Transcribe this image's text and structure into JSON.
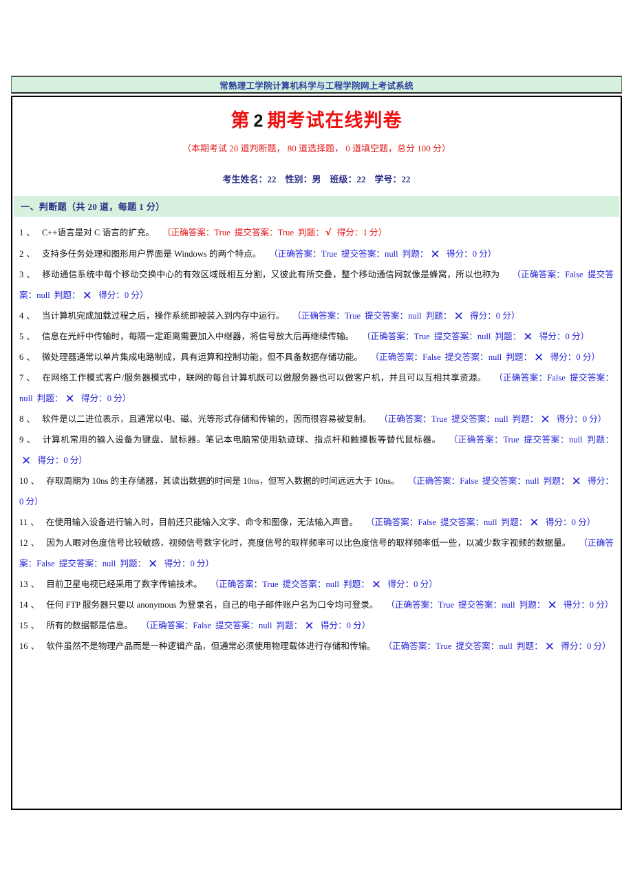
{
  "banner": {
    "site_title": "常熟理工学院计算机科学与工程学院网上考试系统"
  },
  "header": {
    "title_prefix": "第",
    "period_number": "2",
    "title_suffix": "期考试在线判卷",
    "summary": "（本期考试 20 道判断题， 80 道选择题， 0 道填空题，总分 100 分）",
    "student": {
      "name_label": "考生姓名：",
      "name_value": "22",
      "gender_label": "性别：",
      "gender_value": "男",
      "class_label": "班级：",
      "class_value": "22",
      "id_label": "学号：",
      "id_value": "22"
    }
  },
  "section": {
    "heading": "一、判断题（共 20 道，每题 1 分）"
  },
  "labels": {
    "correct_answer": "正确答案：",
    "submitted_answer": "提交答案：",
    "judgement": "判题：",
    "score": "得分：",
    "open_paren": "（",
    "close_paren": "）",
    "mark_right": "√",
    "mark_wrong": "✕",
    "num_sep": "、"
  },
  "colors": {
    "banner_bg": "#d6f2df",
    "banner_text": "#2b3f9e",
    "title_red": "#f01010",
    "student_navy": "#2d2f86",
    "answer_correct": "#e81010",
    "answer_wrong": "#2323d8",
    "border": "#000000"
  },
  "questions": [
    {
      "num": "1",
      "text": "C++语言是对 C 语言的扩充。",
      "correct_answer": "True",
      "submitted_answer": "True",
      "judgement": "√",
      "score": "1 分",
      "state": "correct"
    },
    {
      "num": "2",
      "text": "支持多任务处理和图形用户界面是 Windows 的两个特点。",
      "correct_answer": "True",
      "submitted_answer": "null",
      "judgement": "✕",
      "score": "0 分",
      "state": "wrong"
    },
    {
      "num": "3",
      "text": "移动通信系统中每个移动交换中心的有效区域既相互分割，又彼此有所交叠，整个移动通信网就像是蜂窝，所以也称为",
      "correct_answer": "False",
      "submitted_answer": "null",
      "judgement": "✕",
      "score": "0 分",
      "state": "wrong"
    },
    {
      "num": "4",
      "text": "当计算机完成加载过程之后，操作系统即被装入到内存中运行。",
      "correct_answer": "True",
      "submitted_answer": "null",
      "judgement": "✕",
      "score": "0 分",
      "state": "wrong"
    },
    {
      "num": "5",
      "text": "信息在光纤中传输时，每隔一定距离需要加入中继器，将信号放大后再继续传输。",
      "correct_answer": "True",
      "submitted_answer": "null",
      "judgement": "✕",
      "score": "0 分",
      "state": "wrong"
    },
    {
      "num": "6",
      "text": "微处理器通常以单片集成电路制成，具有运算和控制功能，但不具备数据存储功能。",
      "correct_answer": "False",
      "submitted_answer": "null",
      "judgement": "✕",
      "score": "0 分",
      "state": "wrong"
    },
    {
      "num": "7",
      "text": "在网络工作模式客户/服务器模式中，联网的每台计算机既可以做服务器也可以做客户机，并且可以互相共享资源。",
      "correct_answer": "False",
      "submitted_answer": "null",
      "judgement": "✕",
      "score": "0 分",
      "state": "wrong"
    },
    {
      "num": "8",
      "text": "软件是以二进位表示，且通常以电、磁、光等形式存储和传输的，因而很容易被复制。",
      "correct_answer": "True",
      "submitted_answer": "null",
      "judgement": "✕",
      "score": "0 分",
      "state": "wrong"
    },
    {
      "num": "9",
      "text": "计算机常用的输入设备为键盘、鼠标器。笔记本电脑常使用轨迹球、指点杆和触摸板等替代鼠标器。",
      "correct_answer": "True",
      "submitted_answer": "null",
      "judgement": "✕",
      "score": "0 分",
      "state": "wrong"
    },
    {
      "num": "10",
      "text": "存取周期为 10ns 的主存储器，其读出数据的时间是 10ns，但写入数据的时间远远大于 10ns。",
      "correct_answer": "False",
      "submitted_answer": "null",
      "judgement": "✕",
      "score": "0 分",
      "state": "wrong"
    },
    {
      "num": "11",
      "text": "在使用输入设备进行输入时，目前还只能输入文字、命令和图像，无法输入声音。",
      "correct_answer": "False",
      "submitted_answer": "null",
      "judgement": "✕",
      "score": "0 分",
      "state": "wrong"
    },
    {
      "num": "12",
      "text": "因为人眼对色度信号比较敏感，视频信号数字化时，亮度信号的取样频率可以比色度信号的取样频率低一些，以减少数字视频的数据量。",
      "correct_answer": "False",
      "submitted_answer": "null",
      "judgement": "✕",
      "score": "0 分",
      "state": "wrong"
    },
    {
      "num": "13",
      "text": "目前卫星电视已经采用了数字传输技术。",
      "correct_answer": "True",
      "submitted_answer": "null",
      "judgement": "✕",
      "score": "0 分",
      "state": "wrong"
    },
    {
      "num": "14",
      "text": "任何 FTP 服务器只要以 anonymous 为登录名，自己的电子邮件账户名为口令均可登录。",
      "correct_answer": "True",
      "submitted_answer": "null",
      "judgement": "✕",
      "score": "0 分",
      "state": "wrong"
    },
    {
      "num": "15",
      "text": "所有的数据都是信息。",
      "correct_answer": "False",
      "submitted_answer": "null",
      "judgement": "✕",
      "score": "0 分",
      "state": "wrong"
    },
    {
      "num": "16",
      "text": "软件虽然不是物理产品而是一种逻辑产品，但通常必须使用物理载体进行存储和传输。",
      "correct_answer": "True",
      "submitted_answer": "null",
      "judgement": "✕",
      "score": "0 分",
      "state": "wrong"
    }
  ]
}
